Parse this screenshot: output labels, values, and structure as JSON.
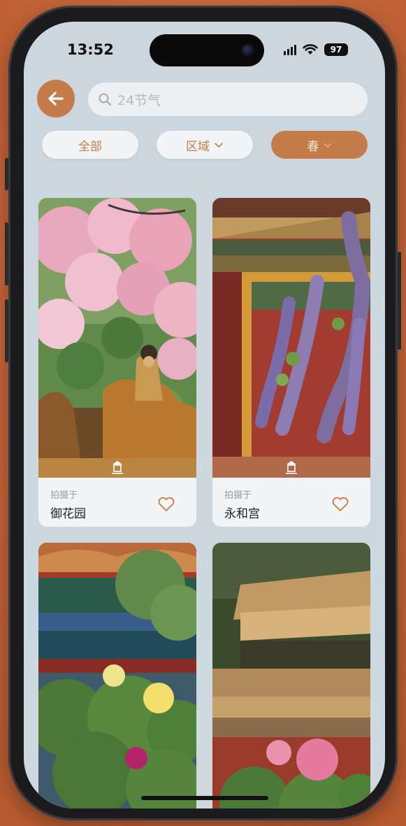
{
  "status_bar": {
    "time": "13:52",
    "battery": "97"
  },
  "search": {
    "placeholder": "24节气"
  },
  "filters": [
    {
      "label": "全部",
      "dropdown": false,
      "selected": false
    },
    {
      "label": "区域",
      "dropdown": true,
      "selected": false
    },
    {
      "label": "春",
      "dropdown": true,
      "selected": true
    }
  ],
  "cards": [
    {
      "caption": "拍摄于",
      "place": "御花园",
      "image": "pink-blossoms-roof-figure"
    },
    {
      "caption": "拍摄于",
      "place": "永和宫",
      "image": "wisteria-red-wall"
    },
    {
      "image": "yellow-peonies-painted-eaves"
    },
    {
      "image": "pink-peonies-roof-tiles"
    }
  ],
  "colors": {
    "accent": "#c47d4a",
    "background": "#cbd6de"
  }
}
